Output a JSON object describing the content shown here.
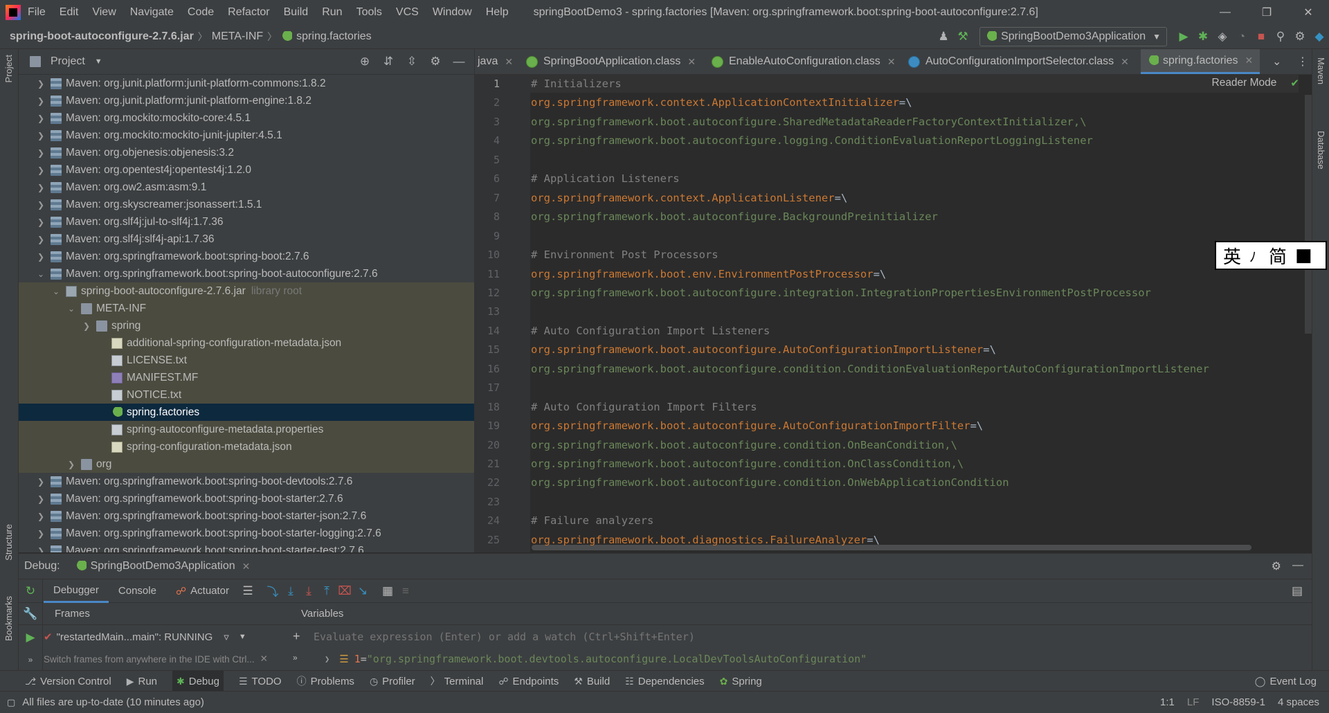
{
  "menu": {
    "items": [
      "File",
      "Edit",
      "View",
      "Navigate",
      "Code",
      "Refactor",
      "Build",
      "Run",
      "Tools",
      "VCS",
      "Window",
      "Help"
    ],
    "window_title": "springBootDemo3 - spring.factories [Maven: org.springframework.boot:spring-boot-autoconfigure:2.7.6]"
  },
  "breadcrumb": [
    "spring-boot-autoconfigure-2.7.6.jar",
    "META-INF",
    "spring.factories"
  ],
  "run_config": "SpringBootDemo3Application",
  "project_panel": {
    "title": "Project",
    "rows": [
      {
        "label": "Maven: org.junit.platform:junit-platform-commons:1.8.2"
      },
      {
        "label": "Maven: org.junit.platform:junit-platform-engine:1.8.2"
      },
      {
        "label": "Maven: org.mockito:mockito-core:4.5.1"
      },
      {
        "label": "Maven: org.mockito:mockito-junit-jupiter:4.5.1"
      },
      {
        "label": "Maven: org.objenesis:objenesis:3.2"
      },
      {
        "label": "Maven: org.opentest4j:opentest4j:1.2.0"
      },
      {
        "label": "Maven: org.ow2.asm:asm:9.1"
      },
      {
        "label": "Maven: org.skyscreamer:jsonassert:1.5.1"
      },
      {
        "label": "Maven: org.slf4j:jul-to-slf4j:1.7.36"
      },
      {
        "label": "Maven: org.slf4j:slf4j-api:1.7.36"
      },
      {
        "label": "Maven: org.springframework.boot:spring-boot:2.7.6"
      },
      {
        "label": "Maven: org.springframework.boot:spring-boot-autoconfigure:2.7.6"
      },
      {
        "label": "spring-boot-autoconfigure-2.7.6.jar",
        "note": "library root"
      },
      {
        "label": "META-INF"
      },
      {
        "label": "spring"
      },
      {
        "label": "additional-spring-configuration-metadata.json"
      },
      {
        "label": "LICENSE.txt"
      },
      {
        "label": "MANIFEST.MF"
      },
      {
        "label": "NOTICE.txt"
      },
      {
        "label": "spring.factories"
      },
      {
        "label": "spring-autoconfigure-metadata.properties"
      },
      {
        "label": "spring-configuration-metadata.json"
      },
      {
        "label": "org"
      },
      {
        "label": "Maven: org.springframework.boot:spring-boot-devtools:2.7.6"
      },
      {
        "label": "Maven: org.springframework.boot:spring-boot-starter:2.7.6"
      },
      {
        "label": "Maven: org.springframework.boot:spring-boot-starter-json:2.7.6"
      },
      {
        "label": "Maven: org.springframework.boot:spring-boot-starter-logging:2.7.6"
      },
      {
        "label": "Maven: org.springframework.boot:spring-boot-starter-test:2.7.6"
      }
    ]
  },
  "tabs": [
    {
      "label": "java"
    },
    {
      "label": "SpringBootApplication.class"
    },
    {
      "label": "EnableAutoConfiguration.class"
    },
    {
      "label": "AutoConfigurationImportSelector.class"
    },
    {
      "label": "spring.factories"
    }
  ],
  "editor": {
    "reader_mode": "Reader Mode",
    "lines": [
      {
        "n": "1",
        "text": "# Initializers"
      },
      {
        "n": "2",
        "text": "org.springframework.context.ApplicationContextInitializer",
        "suffix": "=\\"
      },
      {
        "n": "3",
        "text": "org.springframework.boot.autoconfigure.SharedMetadataReaderFactoryContextInitializer,\\"
      },
      {
        "n": "4",
        "text": "org.springframework.boot.autoconfigure.logging.ConditionEvaluationReportLoggingListener"
      },
      {
        "n": "5",
        "text": ""
      },
      {
        "n": "6",
        "text": "# Application Listeners"
      },
      {
        "n": "7",
        "text": "org.springframework.context.ApplicationListener",
        "suffix": "=\\"
      },
      {
        "n": "8",
        "text": "org.springframework.boot.autoconfigure.BackgroundPreinitializer"
      },
      {
        "n": "9",
        "text": ""
      },
      {
        "n": "10",
        "text": "# Environment Post Processors"
      },
      {
        "n": "11",
        "text": "org.springframework.boot.env.EnvironmentPostProcessor",
        "suffix": "=\\"
      },
      {
        "n": "12",
        "text": "org.springframework.boot.autoconfigure.integration.IntegrationPropertiesEnvironmentPostProcessor"
      },
      {
        "n": "13",
        "text": ""
      },
      {
        "n": "14",
        "text": "# Auto Configuration Import Listeners"
      },
      {
        "n": "15",
        "text": "org.springframework.boot.autoconfigure.AutoConfigurationImportListener",
        "suffix": "=\\"
      },
      {
        "n": "16",
        "text": "org.springframework.boot.autoconfigure.condition.ConditionEvaluationReportAutoConfigurationImportListener"
      },
      {
        "n": "17",
        "text": ""
      },
      {
        "n": "18",
        "text": "# Auto Configuration Import Filters"
      },
      {
        "n": "19",
        "text": "org.springframework.boot.autoconfigure.AutoConfigurationImportFilter",
        "suffix": "=\\"
      },
      {
        "n": "20",
        "text": "org.springframework.boot.autoconfigure.condition.OnBeanCondition,\\"
      },
      {
        "n": "21",
        "text": "org.springframework.boot.autoconfigure.condition.OnClassCondition,\\"
      },
      {
        "n": "22",
        "text": "org.springframework.boot.autoconfigure.condition.OnWebApplicationCondition"
      },
      {
        "n": "23",
        "text": ""
      },
      {
        "n": "24",
        "text": "# Failure analyzers"
      },
      {
        "n": "25",
        "text": "org.springframework.boot.diagnostics.FailureAnalyzer",
        "suffix": "=\\"
      }
    ]
  },
  "ime": {
    "lang": "英",
    "sep": "ﾉ",
    "mode": "简"
  },
  "debug": {
    "label": "Debug:",
    "session": "SpringBootDemo3Application",
    "tabs": [
      "Debugger",
      "Console",
      "Actuator"
    ],
    "frames_label": "Frames",
    "variables_label": "Variables",
    "thread": "\"restartedMain...main\": RUNNING",
    "hint": "Switch frames from anywhere in the IDE with Ctrl...",
    "watch_placeholder": "Evaluate expression (Enter) or add a watch (Ctrl+Shift+Enter)",
    "variable": {
      "index": "1",
      "eq": " = ",
      "value": "\"org.springframework.boot.devtools.autoconfigure.LocalDevToolsAutoConfiguration\""
    }
  },
  "tool_windows": [
    "Version Control",
    "Run",
    "Debug",
    "TODO",
    "Problems",
    "Profiler",
    "Terminal",
    "Endpoints",
    "Build",
    "Dependencies",
    "Spring"
  ],
  "event_log": "Event Log",
  "side_labels": {
    "project": "Project",
    "structure": "Structure",
    "bookmarks": "Bookmarks",
    "maven": "Maven",
    "database": "Database"
  },
  "status": {
    "message": "All files are up-to-date (10 minutes ago)",
    "position": "1:1",
    "line_sep": "LF",
    "encoding": "ISO-8859-1",
    "indent": "4 spaces"
  }
}
